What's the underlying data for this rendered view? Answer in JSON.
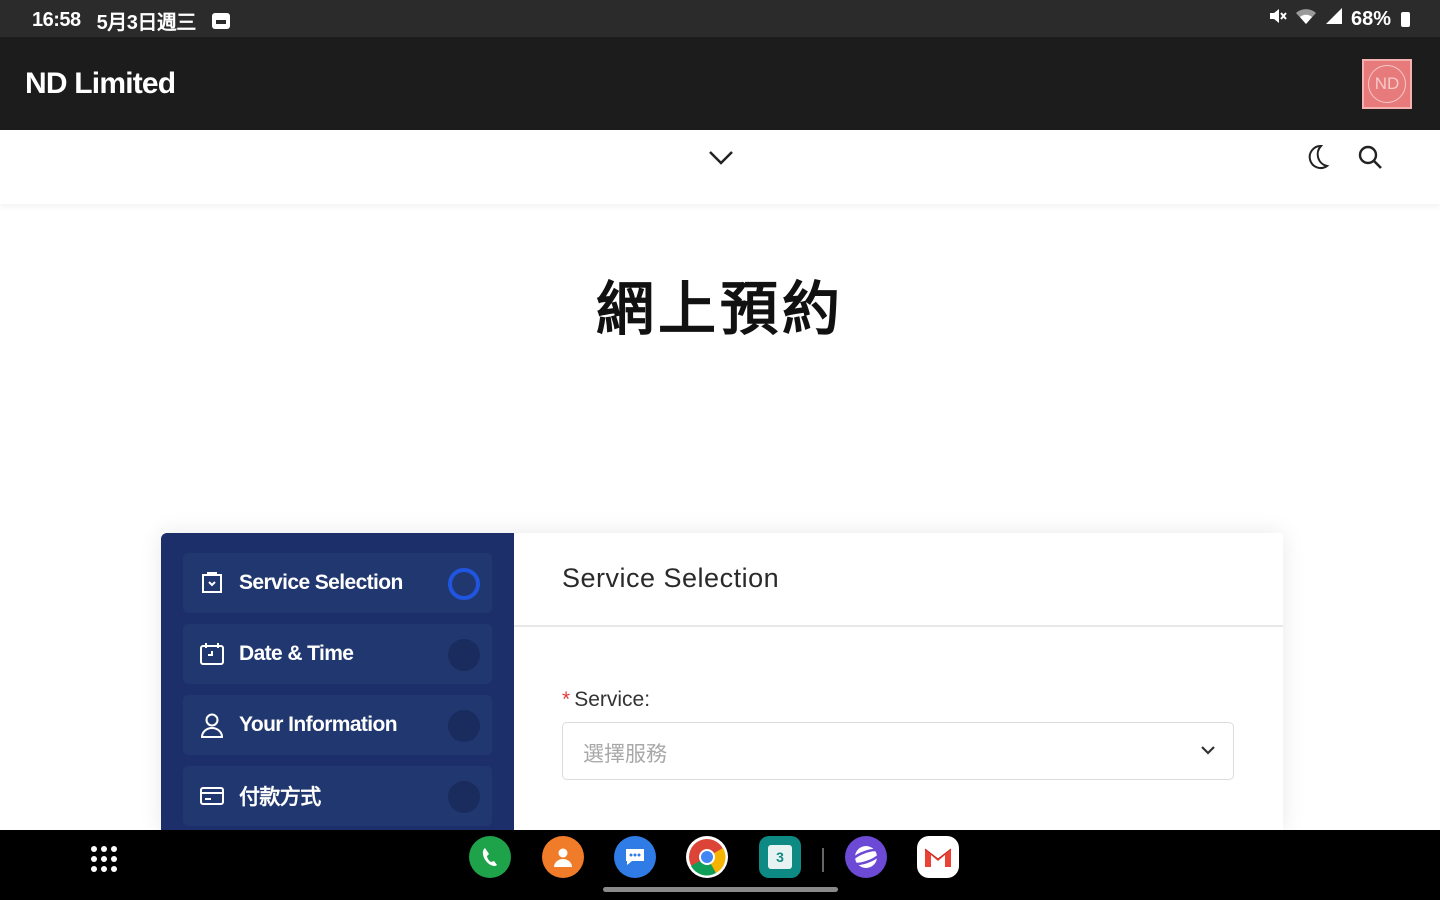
{
  "status_bar": {
    "time": "16:58",
    "date": "5月3日週三",
    "battery": "68%",
    "icons": [
      "image-icon",
      "mute-icon",
      "wifi-icon",
      "signal-icon",
      "battery-icon"
    ]
  },
  "app_bar": {
    "title": "ND Limited",
    "avatar_text": "ND",
    "avatar_color": "#e77b7b"
  },
  "sub_nav": {
    "icons": [
      "chevron-down-icon",
      "moon-icon",
      "search-icon"
    ]
  },
  "page": {
    "title": "網上預約"
  },
  "booking": {
    "steps": [
      {
        "label": "Service Selection",
        "icon": "service-icon",
        "active": true
      },
      {
        "label": "Date & Time",
        "icon": "calendar-icon",
        "active": false
      },
      {
        "label": "Your Information",
        "icon": "user-icon",
        "active": false
      },
      {
        "label": "付款方式",
        "icon": "payment-icon",
        "active": false
      }
    ],
    "section_title": "Service Selection",
    "service_field": {
      "required_mark": "*",
      "label": "Service:",
      "placeholder": "選擇服務"
    },
    "sidebar_color": "#1c2f6a",
    "active_color": "#1f55e0"
  },
  "dock": {
    "apps": [
      "phone",
      "contacts",
      "messages",
      "chrome",
      "calendar",
      "internet",
      "gmail"
    ],
    "calendar_day": "3"
  }
}
